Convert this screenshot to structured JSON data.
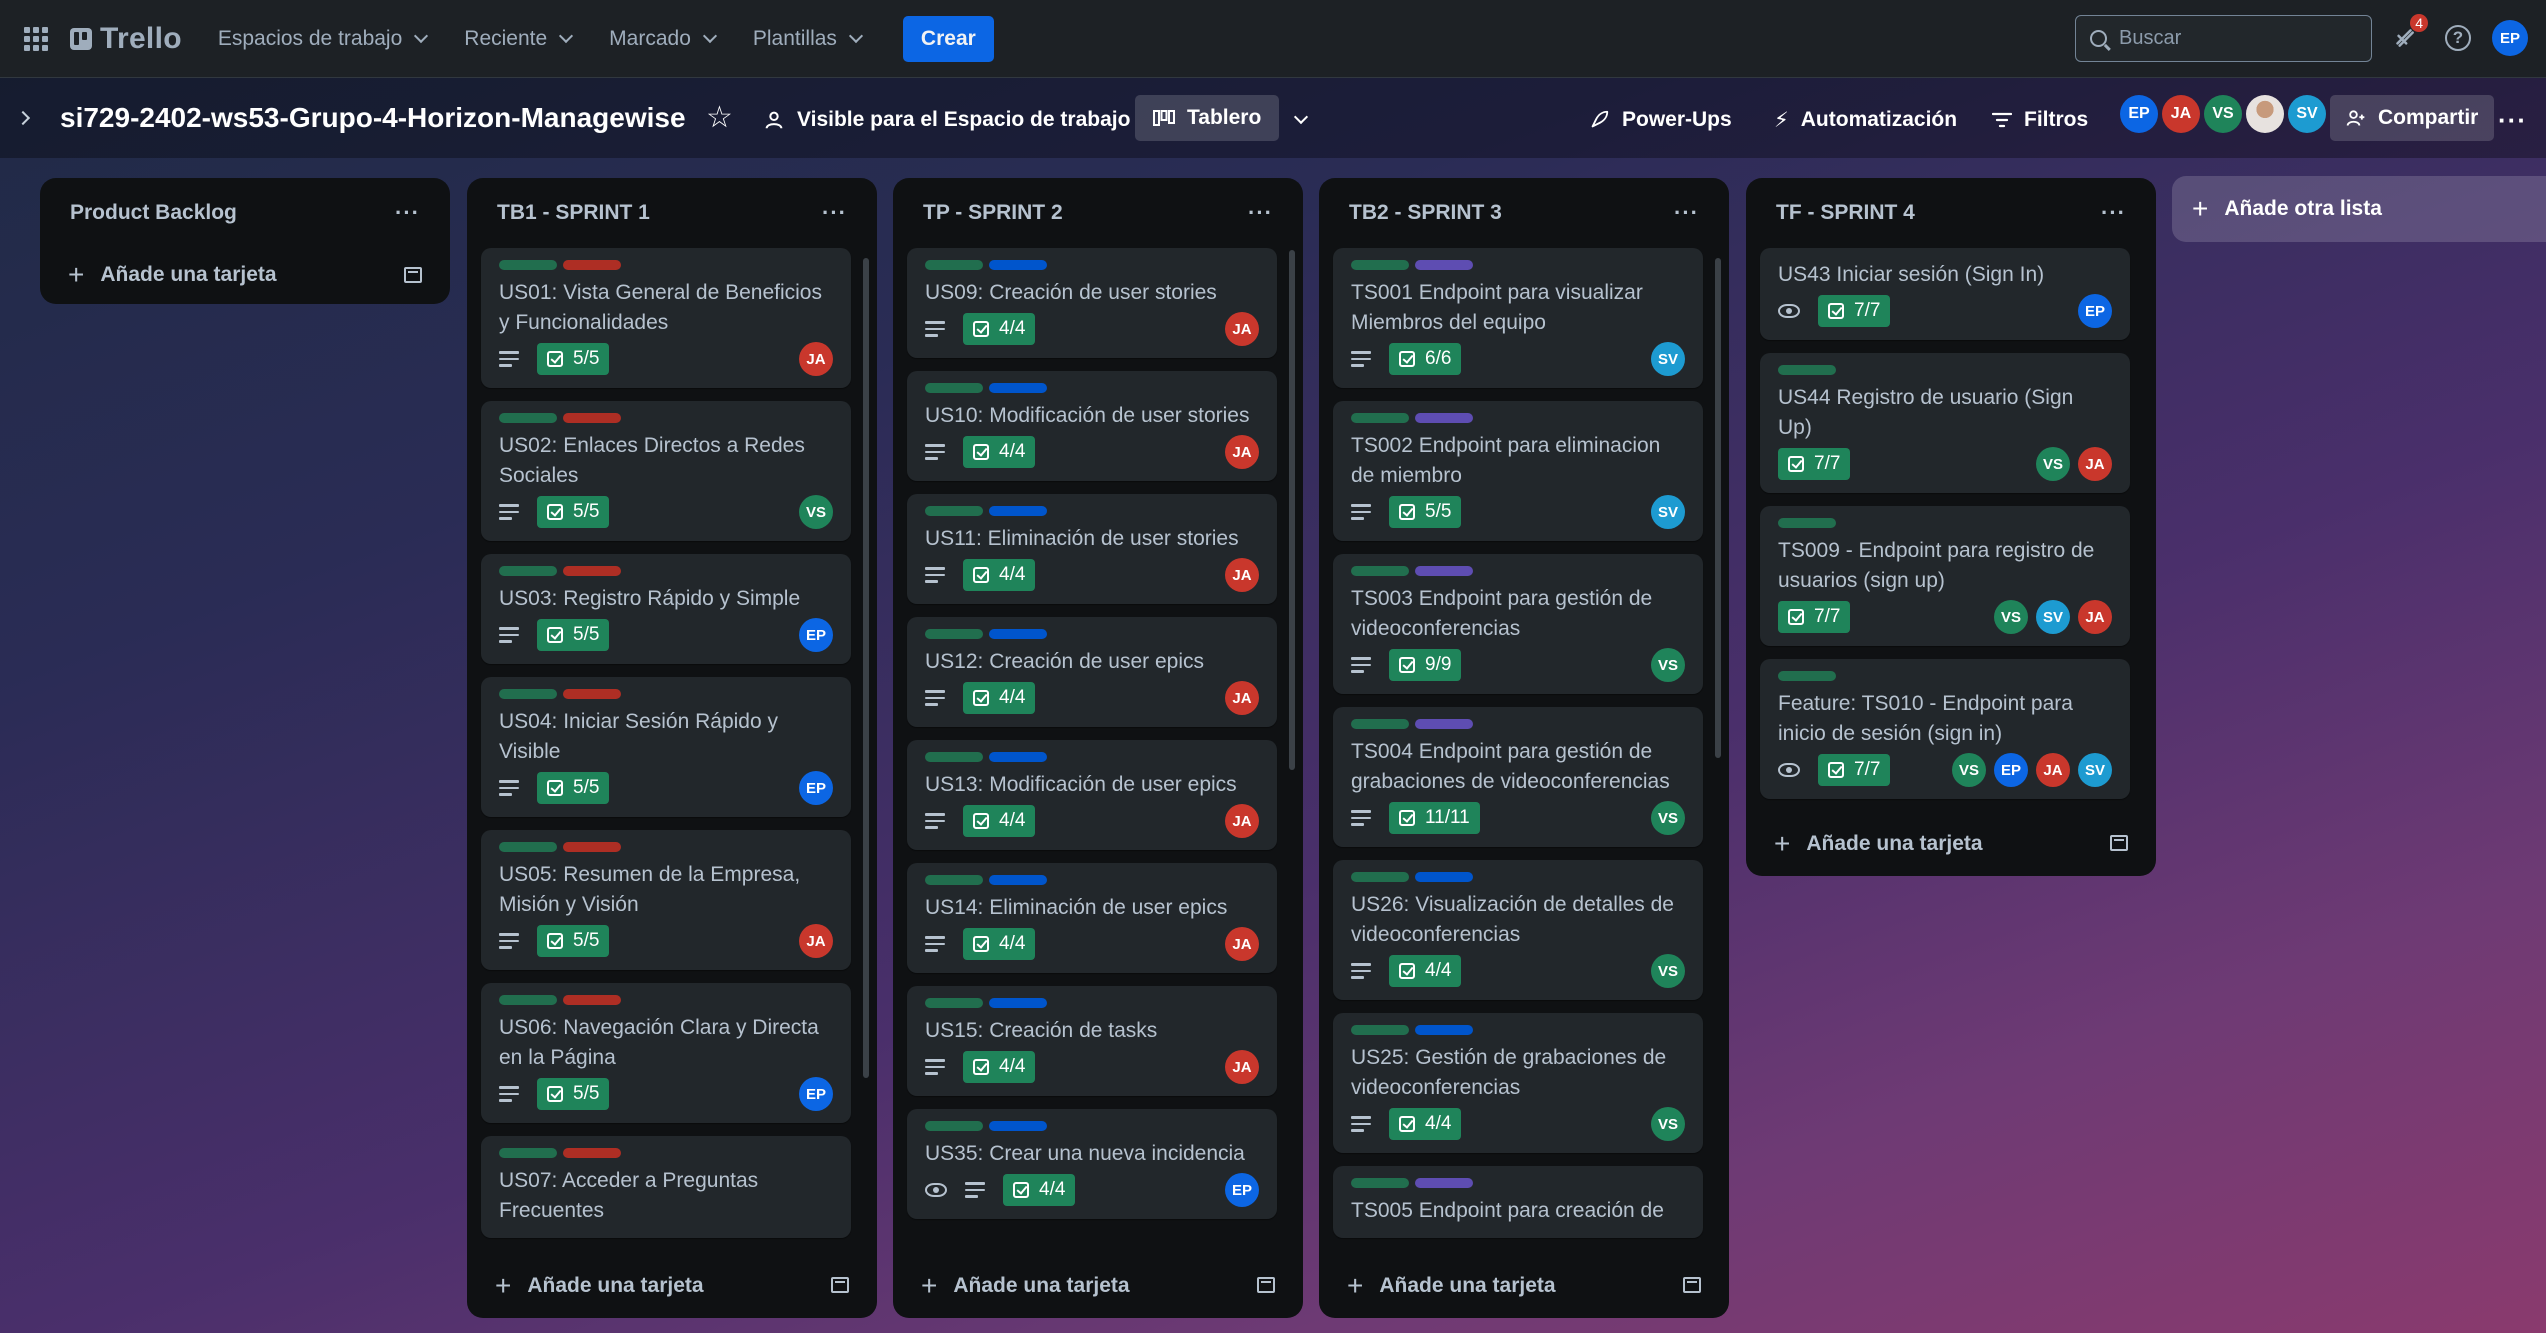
{
  "nav": {
    "logo": "Trello",
    "menus": [
      "Espacios de trabajo",
      "Reciente",
      "Marcado",
      "Plantillas"
    ],
    "create": "Crear",
    "search_placeholder": "Buscar",
    "notifications_count": "4",
    "user_initials": "EP"
  },
  "board": {
    "title": "si729-2402-ws53-Grupo-4-Horizon-Managewise",
    "visibility": "Visible para el Espacio de trabajo",
    "view": "Tablero",
    "powerups": "Power-Ups",
    "automation": "Automatización",
    "filters": "Filtros",
    "members": [
      "EP",
      "JA",
      "VS",
      "",
      "SV"
    ],
    "share": "Compartir"
  },
  "colors": {
    "label_green": "#216e4e",
    "label_red": "#ae2e24",
    "label_blue": "#0055cc",
    "label_purple": "#5e4db2",
    "checklist": "#1f845a",
    "EP": "#0c66e4",
    "JA": "#c9372c",
    "VS": "#1f845a",
    "SV": "#1d9bd1"
  },
  "lists": [
    {
      "title": "Product Backlog",
      "add_card": "Añade una tarjeta",
      "cards": []
    },
    {
      "title": "TB1 - SPRINT 1",
      "add_card": "Añade una tarjeta",
      "cards": [
        {
          "labels": [
            "green",
            "red"
          ],
          "title": "US01: Vista General de Beneficios y Funcionalidades",
          "desc": true,
          "watch": false,
          "checklist": "5/5",
          "members": [
            "JA"
          ]
        },
        {
          "labels": [
            "green",
            "red"
          ],
          "title": "US02: Enlaces Directos a Redes Sociales",
          "desc": true,
          "watch": false,
          "checklist": "5/5",
          "members": [
            "VS"
          ]
        },
        {
          "labels": [
            "green",
            "red"
          ],
          "title": "US03: Registro Rápido y Simple",
          "desc": true,
          "watch": false,
          "checklist": "5/5",
          "members": [
            "EP"
          ]
        },
        {
          "labels": [
            "green",
            "red"
          ],
          "title": "US04: Iniciar Sesión Rápido y Visible",
          "desc": true,
          "watch": false,
          "checklist": "5/5",
          "members": [
            "EP"
          ]
        },
        {
          "labels": [
            "green",
            "red"
          ],
          "title": "US05: Resumen de la Empresa, Misión y Visión",
          "desc": true,
          "watch": false,
          "checklist": "5/5",
          "members": [
            "JA"
          ]
        },
        {
          "labels": [
            "green",
            "red"
          ],
          "title": "US06: Navegación Clara y Directa en la Página",
          "desc": true,
          "watch": false,
          "checklist": "5/5",
          "members": [
            "EP"
          ]
        },
        {
          "labels": [
            "green",
            "red"
          ],
          "title": "US07: Acceder a Preguntas Frecuentes",
          "desc": false,
          "watch": false,
          "checklist": "",
          "members": []
        }
      ]
    },
    {
      "title": "TP - SPRINT 2",
      "add_card": "Añade una tarjeta",
      "cards": [
        {
          "labels": [
            "green",
            "blue"
          ],
          "title": "US09: Creación de user stories",
          "desc": true,
          "watch": false,
          "checklist": "4/4",
          "members": [
            "JA"
          ]
        },
        {
          "labels": [
            "green",
            "blue"
          ],
          "title": "US10: Modificación de user stories",
          "desc": true,
          "watch": false,
          "checklist": "4/4",
          "members": [
            "JA"
          ]
        },
        {
          "labels": [
            "green",
            "blue"
          ],
          "title": "US11: Eliminación de user stories",
          "desc": true,
          "watch": false,
          "checklist": "4/4",
          "members": [
            "JA"
          ]
        },
        {
          "labels": [
            "green",
            "blue"
          ],
          "title": "US12: Creación de user epics",
          "desc": true,
          "watch": false,
          "checklist": "4/4",
          "members": [
            "JA"
          ]
        },
        {
          "labels": [
            "green",
            "blue"
          ],
          "title": "US13: Modificación de user epics",
          "desc": true,
          "watch": false,
          "checklist": "4/4",
          "members": [
            "JA"
          ]
        },
        {
          "labels": [
            "green",
            "blue"
          ],
          "title": "US14: Eliminación de user epics",
          "desc": true,
          "watch": false,
          "checklist": "4/4",
          "members": [
            "JA"
          ]
        },
        {
          "labels": [
            "green",
            "blue"
          ],
          "title": "US15: Creación de tasks",
          "desc": true,
          "watch": false,
          "checklist": "4/4",
          "members": [
            "JA"
          ]
        },
        {
          "labels": [
            "green",
            "blue"
          ],
          "title": "US35: Crear una nueva incidencia",
          "desc": true,
          "watch": true,
          "checklist": "4/4",
          "members": [
            "EP"
          ]
        }
      ]
    },
    {
      "title": "TB2 - SPRINT 3",
      "add_card": "Añade una tarjeta",
      "cards": [
        {
          "labels": [
            "green",
            "purple"
          ],
          "title": "TS001 Endpoint para visualizar Miembros del equipo",
          "desc": true,
          "watch": false,
          "checklist": "6/6",
          "members": [
            "SV"
          ]
        },
        {
          "labels": [
            "green",
            "purple"
          ],
          "title": "TS002 Endpoint para eliminacion de miembro",
          "desc": true,
          "watch": false,
          "checklist": "5/5",
          "members": [
            "SV"
          ]
        },
        {
          "labels": [
            "green",
            "purple"
          ],
          "title": "TS003 Endpoint para gestión de videoconferencias",
          "desc": true,
          "watch": false,
          "checklist": "9/9",
          "members": [
            "VS"
          ]
        },
        {
          "labels": [
            "green",
            "purple"
          ],
          "title": "TS004 Endpoint para gestión de grabaciones de videoconferencias",
          "desc": true,
          "watch": false,
          "checklist": "11/11",
          "members": [
            "VS"
          ]
        },
        {
          "labels": [
            "green",
            "blue"
          ],
          "title": "US26: Visualización de detalles de videoconferencias",
          "desc": true,
          "watch": false,
          "checklist": "4/4",
          "members": [
            "VS"
          ]
        },
        {
          "labels": [
            "green",
            "blue"
          ],
          "title": "US25: Gestión de grabaciones de videoconferencias",
          "desc": true,
          "watch": false,
          "checklist": "4/4",
          "members": [
            "VS"
          ]
        },
        {
          "labels": [
            "green",
            "purple"
          ],
          "title": "TS005 Endpoint para creación de",
          "desc": false,
          "watch": false,
          "checklist": "",
          "members": []
        }
      ]
    },
    {
      "title": "TF - SPRINT 4",
      "add_card": "Añade una tarjeta",
      "cards": [
        {
          "labels": [],
          "title": "US43 Iniciar sesión (Sign In)",
          "desc": false,
          "watch": true,
          "checklist": "7/7",
          "members": [
            "EP"
          ]
        },
        {
          "labels": [
            "green"
          ],
          "title": "US44 Registro de usuario (Sign Up)",
          "desc": false,
          "watch": false,
          "checklist": "7/7",
          "members": [
            "VS",
            "JA"
          ]
        },
        {
          "labels": [
            "green"
          ],
          "title": "TS009 - Endpoint para registro de usuarios (sign up)",
          "desc": false,
          "watch": false,
          "checklist": "7/7",
          "members": [
            "VS",
            "SV",
            "JA"
          ]
        },
        {
          "labels": [
            "green"
          ],
          "title": "Feature: TS010 - Endpoint para inicio de sesión (sign in)",
          "desc": false,
          "watch": true,
          "checklist": "7/7",
          "members": [
            "VS",
            "EP",
            "JA",
            "SV"
          ]
        }
      ]
    }
  ],
  "add_list": "Añade otra lista"
}
